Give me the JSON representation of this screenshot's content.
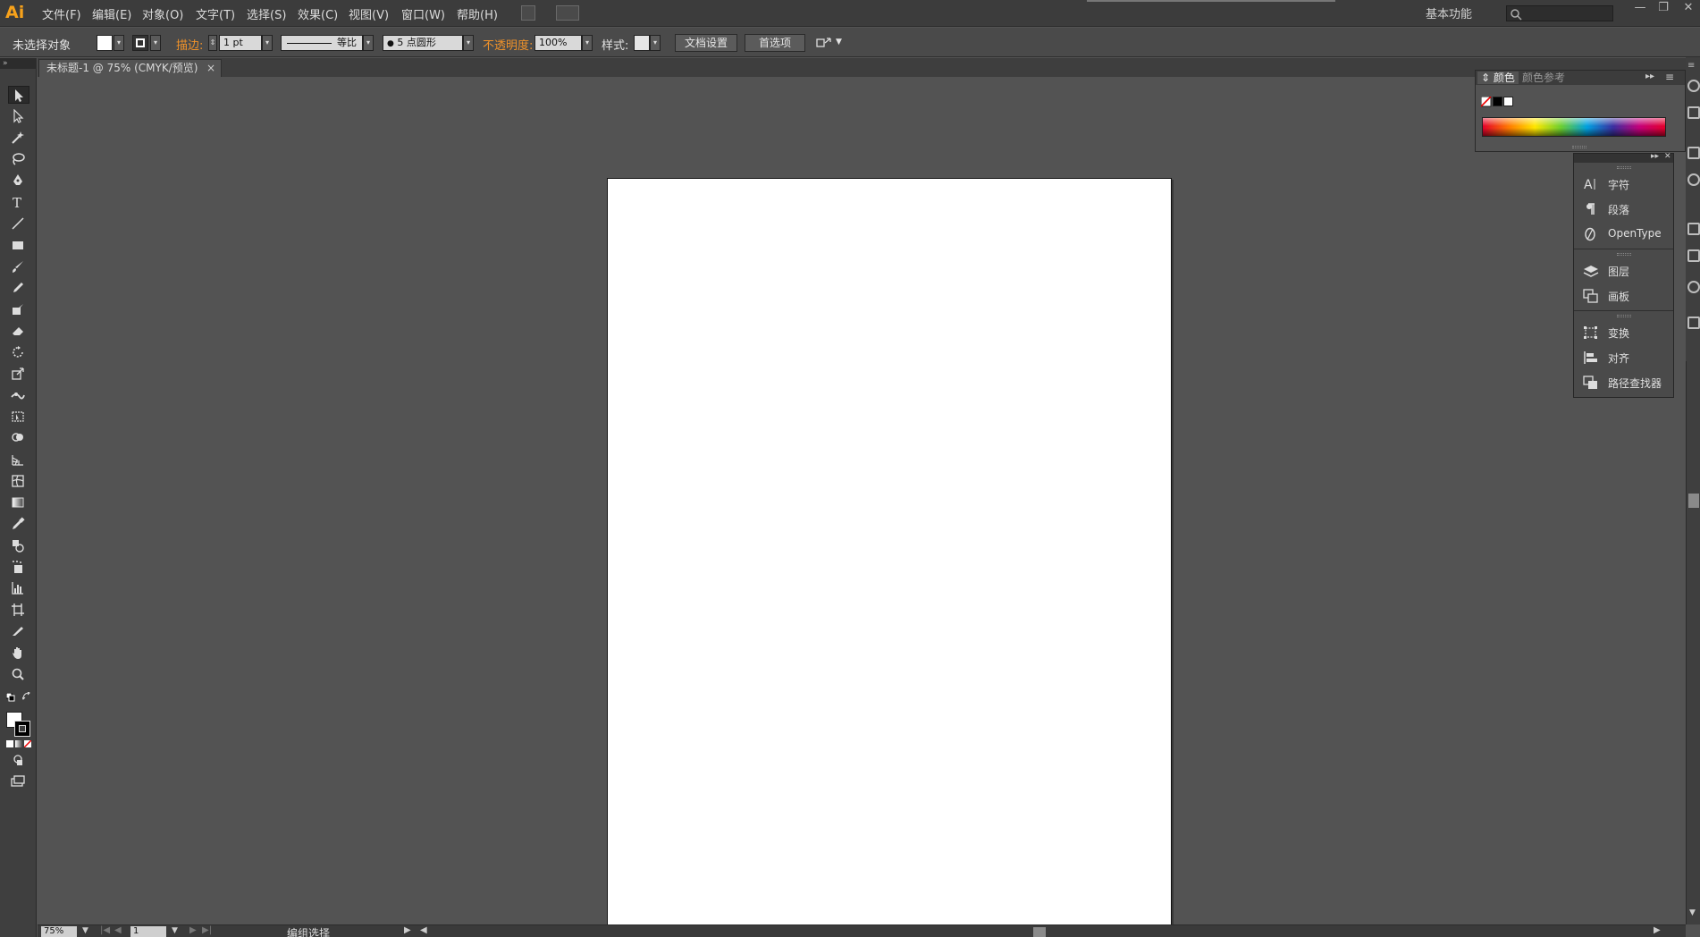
{
  "app": {
    "logo": "Ai",
    "accent_color": "#f7a21b"
  },
  "menu": {
    "items": [
      "文件(F)",
      "编辑(E)",
      "对象(O)",
      "文字(T)",
      "选择(S)",
      "效果(C)",
      "视图(V)",
      "窗口(W)",
      "帮助(H)"
    ],
    "workspace": "基本功能",
    "win_minimize": "—",
    "win_restore": "❐",
    "win_close": "✕"
  },
  "control": {
    "selection_status": "未选择对象",
    "stroke_label": "描边:",
    "stroke_weight": "1 pt",
    "stroke_profile": "等比",
    "brush": "5 点圆形",
    "opacity_label": "不透明度:",
    "opacity_value": "100%",
    "style_label": "样式:",
    "doc_setup": "文档设置",
    "preferences": "首选项"
  },
  "document": {
    "tab_title": "未标题-1 @ 75% (CMYK/预览)",
    "tab_close": "×"
  },
  "status_bar": {
    "zoom": "75%",
    "page": "1",
    "info": "编组选择"
  },
  "color_panel": {
    "tab_active": "颜色",
    "tab_inactive": "颜色参考",
    "collapse": "▸▸",
    "menu": "≡"
  },
  "dock": {
    "items": [
      {
        "label": "字符",
        "icon": "character-icon"
      },
      {
        "label": "段落",
        "icon": "paragraph-icon"
      },
      {
        "label": "OpenType",
        "icon": "opentype-icon"
      },
      {
        "label": "图层",
        "icon": "layers-icon"
      },
      {
        "label": "画板",
        "icon": "artboards-icon"
      },
      {
        "label": "变换",
        "icon": "transform-icon"
      },
      {
        "label": "对齐",
        "icon": "align-icon"
      },
      {
        "label": "路径查找器",
        "icon": "pathfinder-icon"
      }
    ]
  }
}
